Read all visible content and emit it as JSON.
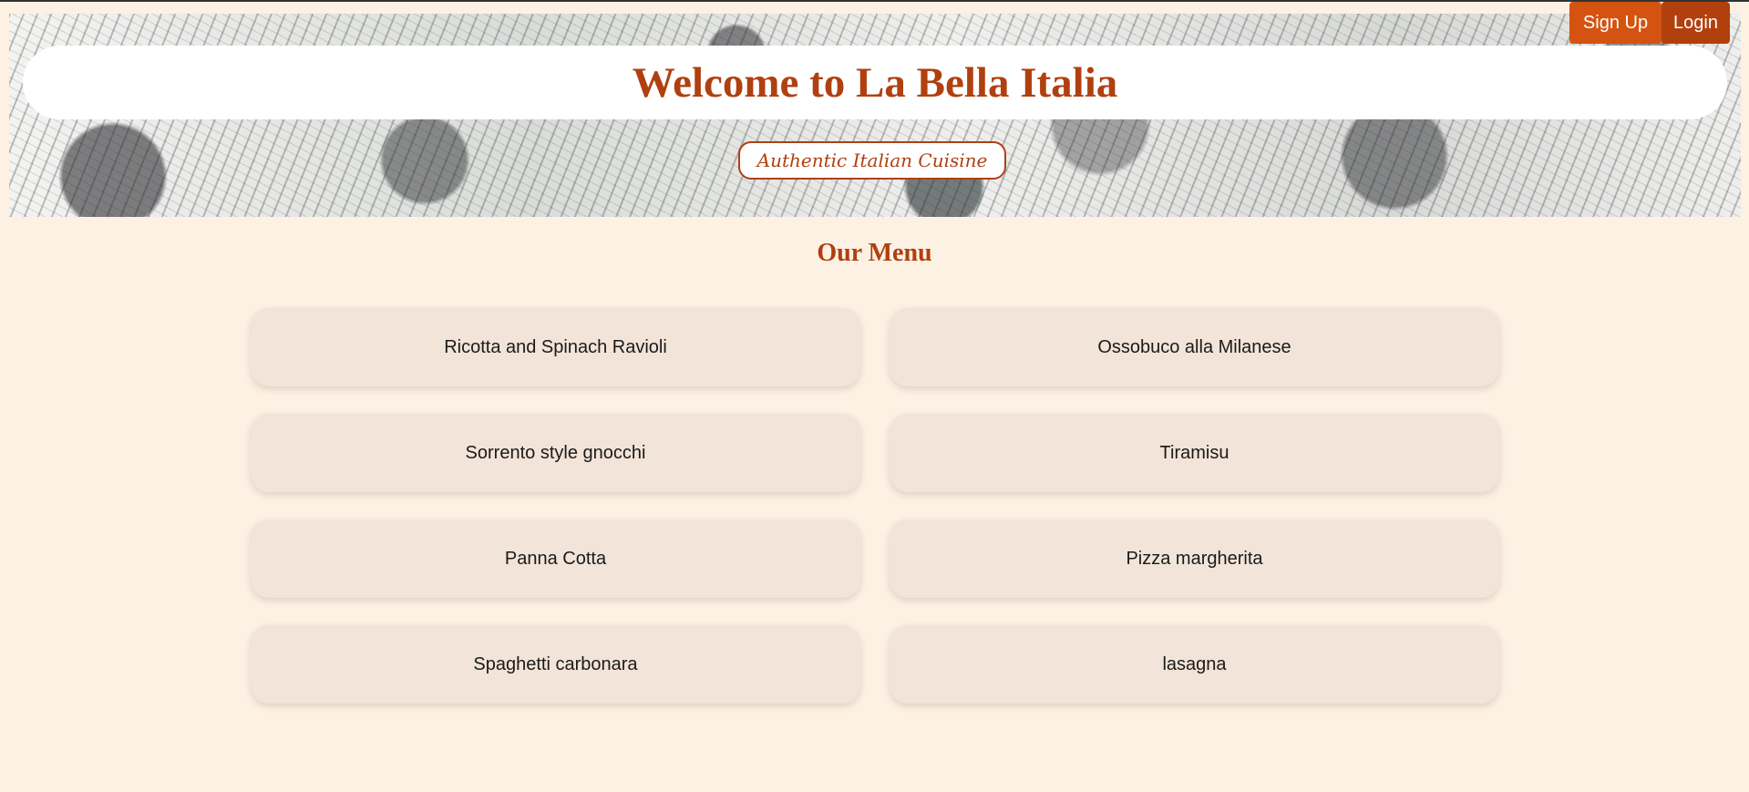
{
  "header": {
    "title": "Welcome to La Bella Italia",
    "tagline": "Authentic Italian Cuisine",
    "signup_label": "Sign Up",
    "login_label": "Login"
  },
  "menu": {
    "heading": "Our Menu",
    "items": [
      "Ricotta and Spinach Ravioli",
      "Ossobuco alla Milanese",
      "Sorrento style gnocchi",
      "Tiramisu",
      "Panna Cotta",
      "Pizza margherita",
      "Spaghetti carbonara",
      "lasagna"
    ]
  },
  "colors": {
    "accent": "#b04010",
    "signup_button": "#d45310",
    "login_button": "#b2400d",
    "page_background": "#fdf1e4",
    "card_background": "#f2e4d8"
  }
}
